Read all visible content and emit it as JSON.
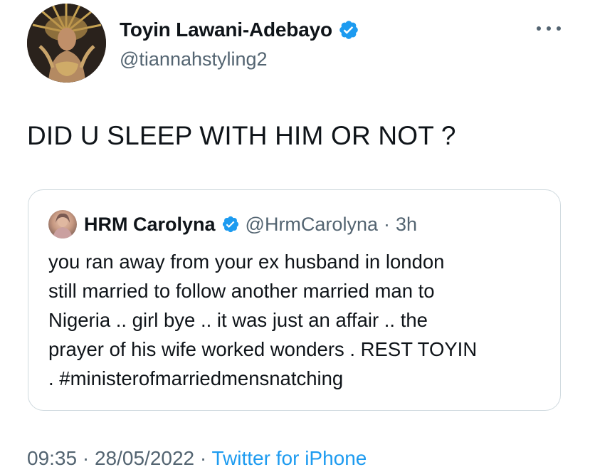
{
  "author": {
    "display_name": "Toyin Lawani-Adebayo",
    "handle": "@tiannahstyling2",
    "verified": true
  },
  "tweet": {
    "text": "DID U SLEEP WITH HIM OR NOT ?"
  },
  "quoted": {
    "display_name": "HRM Carolyna",
    "handle": "@HrmCarolyna",
    "separator": "·",
    "time": "3h",
    "verified": true,
    "lines": [
      "you ran away from your ex husband in london",
      "still married to follow another married man to",
      "Nigeria .. girl bye .. it was just an affair .. the",
      "prayer of his wife worked wonders . REST TOYIN",
      ". #ministerofmarriedmensnatching"
    ]
  },
  "footer": {
    "time": "09:35",
    "sep1": "·",
    "date": "28/05/2022",
    "sep2": "·",
    "source": "Twitter for iPhone"
  },
  "colors": {
    "text": "#0f1419",
    "secondary": "#536471",
    "accent": "#1d9bf0",
    "border": "#cfd9de"
  },
  "icons": {
    "verified": "verified-badge-icon",
    "more": "more-horizontal-icon"
  }
}
